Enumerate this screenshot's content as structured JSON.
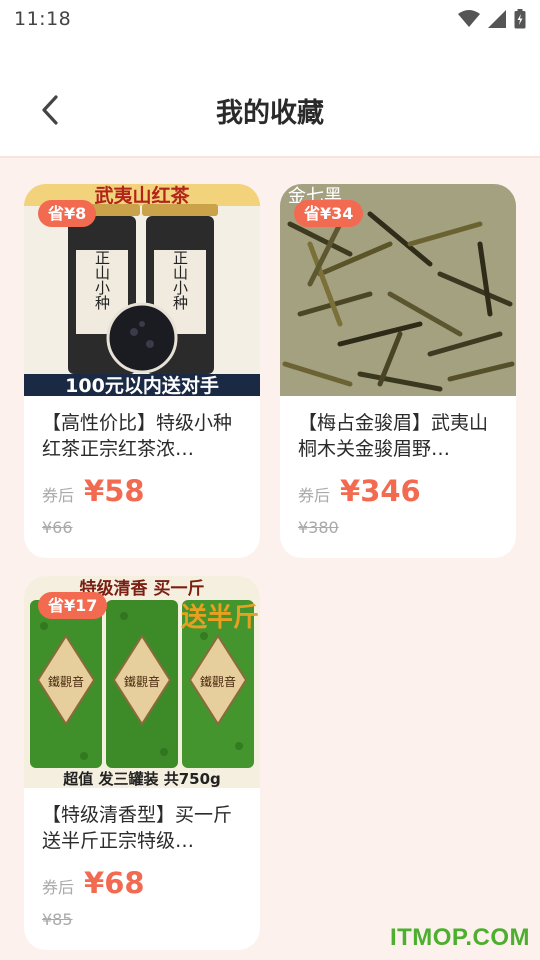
{
  "status_bar": {
    "time": "11:18"
  },
  "header": {
    "title": "我的收藏"
  },
  "products": [
    {
      "badge": "省¥8",
      "title": "【高性价比】特级小种红茶正宗红茶浓…",
      "price_label": "券后",
      "price": "¥58",
      "original_price": "¥66",
      "image_text": {
        "top": "武夷山红茶",
        "bottom": "100元以内送对手",
        "can1": "正山小种",
        "can2": "正山小种"
      }
    },
    {
      "badge": "省¥34",
      "title": "【梅占金骏眉】武夷山桐木关金骏眉野…",
      "price_label": "券后",
      "price": "¥346",
      "original_price": "¥380",
      "image_text": {
        "top": "金七黑"
      }
    },
    {
      "badge": "省¥17",
      "title": "【特级清香型】买一斤送半斤正宗特级…",
      "price_label": "券后",
      "price": "¥68",
      "original_price": "¥85",
      "image_text": {
        "top": "特级清香 买一斤",
        "promo": "送半斤",
        "can": "鐵觀音",
        "bottom": "超值  发三罐装  共750g"
      }
    }
  ],
  "watermark": "ITMOP.COM",
  "colors": {
    "accent": "#f26a4f",
    "background": "#fdf1ee",
    "watermark": "#4caf2e"
  }
}
